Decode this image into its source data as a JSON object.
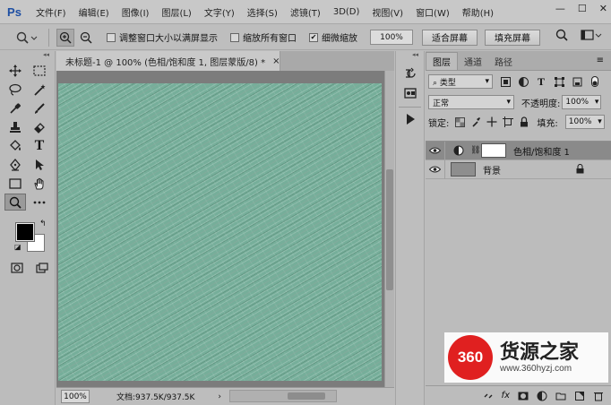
{
  "app": {
    "logo": "Ps"
  },
  "menu": [
    "文件(F)",
    "编辑(E)",
    "图像(I)",
    "图层(L)",
    "文字(Y)",
    "选择(S)",
    "滤镜(T)",
    "3D(D)",
    "视图(V)",
    "窗口(W)",
    "帮助(H)"
  ],
  "window_controls": {
    "minimize": "—",
    "maximize": "☐",
    "close": "✕"
  },
  "options_bar": {
    "resize_window_label": "调整窗口大小以满屏显示",
    "resize_window_checked": false,
    "zoom_all_label": "缩放所有窗口",
    "zoom_all_checked": false,
    "scrubby_zoom_label": "细微缩放",
    "scrubby_zoom_checked": true,
    "zoom_percent": "100%",
    "fit_screen": "适合屏幕",
    "fill_screen": "填充屏幕"
  },
  "document": {
    "tab_title": "未标题-1 @ 100% (色相/饱和度 1, 图层蒙版/8) *",
    "close": "×",
    "canvas_color": "#76ae9a",
    "zoom": "100%",
    "doc_info": "文档:937.5K/937.5K",
    "info_arrow": "›"
  },
  "tools": {
    "foreground_color": "#000000",
    "background_color": "#ffffff",
    "swap": "↰",
    "reset": "◪",
    "items": [
      "move-icon",
      "marquee-icon",
      "lasso-icon",
      "magic-wand-icon",
      "eyedropper-icon",
      "brush-icon",
      "stamp-icon",
      "eraser-icon",
      "paint-bucket-icon",
      "type-icon",
      "pen-icon",
      "path-selection-icon",
      "rectangle-icon",
      "hand-icon",
      "zoom-icon",
      "more-tools-icon"
    ]
  },
  "layers_panel": {
    "tabs": [
      "图层",
      "通道",
      "路径"
    ],
    "menu": "≡",
    "kind_filter": "类型",
    "blend_mode": "正常",
    "opacity_label": "不透明度:",
    "opacity_value": "100%",
    "lock_label": "锁定:",
    "fill_label": "填充:",
    "fill_value": "100%",
    "layers": [
      {
        "name": "色相/饱和度 1",
        "visible": true,
        "selected": true
      },
      {
        "name": "背景",
        "visible": true,
        "selected": false,
        "locked": true
      }
    ]
  },
  "watermark": {
    "badge": "360",
    "title": "货源之家",
    "url": "www.360hyzj.com"
  }
}
